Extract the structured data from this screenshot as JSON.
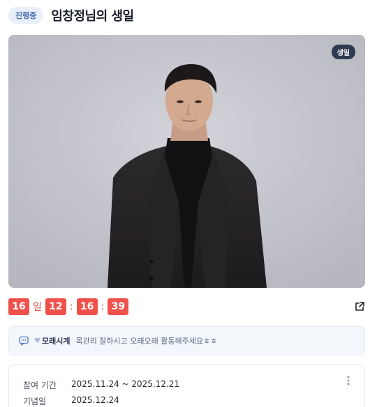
{
  "header": {
    "status": "진행중",
    "title": "임창정님의 생일"
  },
  "hero": {
    "tag": "생일",
    "image_icon": "person-photo"
  },
  "countdown": {
    "days": "16",
    "days_unit": "일",
    "hours": "12",
    "minutes": "16",
    "seconds": "39",
    "separator": ":"
  },
  "share": {
    "icon": "share-icon"
  },
  "message": {
    "icon": "chat-icon",
    "heart": "♥",
    "author": "모래시계",
    "text": "목관리 잘하시고 오래오래 활동해주세요ㅎㅎ"
  },
  "info": {
    "period_label": "참여 기간",
    "period_value": "2025.11.24 ~ 2025.12.21",
    "anniversary_label": "기념일",
    "anniversary_value": "2025.12.24",
    "more_icon": "more-vertical-icon"
  },
  "colors": {
    "accent": "#f0524b",
    "pill_bg": "#e8effb",
    "pill_text": "#4a6fb3",
    "tag_bg": "#303a52"
  }
}
